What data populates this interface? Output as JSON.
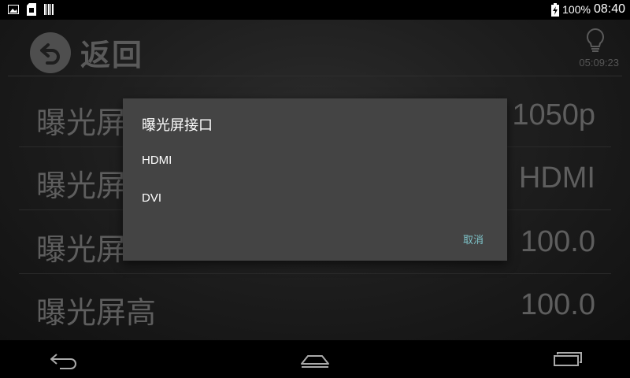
{
  "status_bar": {
    "battery_percent": "100%",
    "time": "08:40",
    "icons": [
      "image-icon",
      "sdcard-icon",
      "barcode-icon",
      "battery-charging-icon"
    ]
  },
  "header": {
    "back_label": "返回",
    "clock": "05:09:23",
    "icons": [
      "back-arrow-icon",
      "lightbulb-icon"
    ]
  },
  "settings": {
    "rows": [
      {
        "label": "曝光屏",
        "value": "1050p"
      },
      {
        "label": "曝光屏",
        "value": "HDMI"
      },
      {
        "label": "曝光屏",
        "value": "100.0"
      },
      {
        "label": "曝光屏高",
        "value": "100.0"
      }
    ]
  },
  "dialog": {
    "title": "曝光屏接口",
    "options": [
      "HDMI",
      "DVI"
    ],
    "cancel_label": "取消",
    "accent_color": "#7ec3c9"
  },
  "nav_bar": {
    "icons": [
      "nav-back-icon",
      "nav-home-icon",
      "nav-recents-icon"
    ]
  }
}
